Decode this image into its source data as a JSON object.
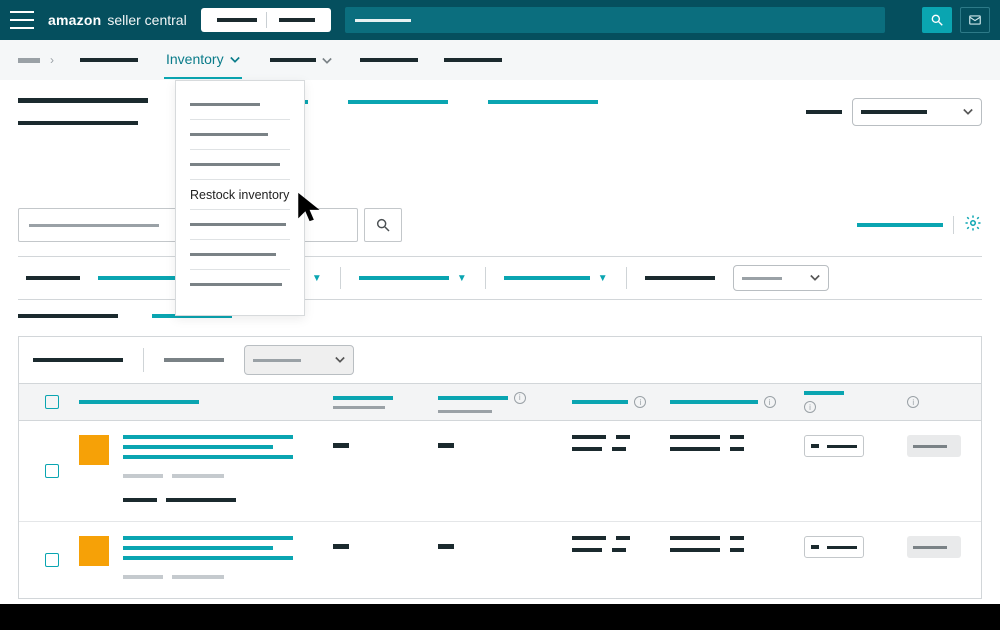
{
  "brand": {
    "amazon": "amazon",
    "sc": "seller central"
  },
  "nav": {
    "inventory": "Inventory"
  },
  "menu": {
    "restock": "Restock inventory"
  },
  "icons": {
    "hamburger": "menu-icon",
    "search": "search-icon",
    "mail": "mail-icon",
    "gear": "gear-icon",
    "chevron": "chevron-down-icon",
    "cursor": "cursor-icon"
  },
  "colors": {
    "header": "#054f5e",
    "accent": "#0aa5b1",
    "thumb": "#f6a107"
  }
}
